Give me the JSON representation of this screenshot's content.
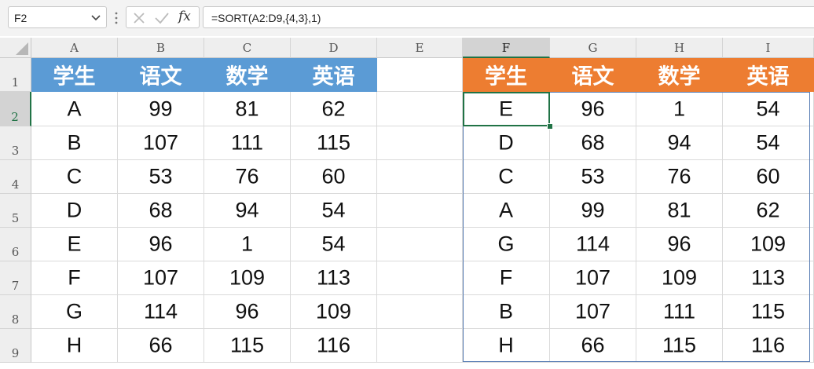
{
  "formula_bar": {
    "name_box": "F2",
    "formula": "=SORT(A2:D9,{4,3},1)",
    "fx_label": "fx"
  },
  "columns": [
    "A",
    "B",
    "C",
    "D",
    "E",
    "F",
    "G",
    "H",
    "I"
  ],
  "selected_column": "F",
  "rows": [
    "1",
    "2",
    "3",
    "4",
    "5",
    "6",
    "7",
    "8",
    "9"
  ],
  "selected_row": "2",
  "source_table": {
    "headers": [
      "学生",
      "语文",
      "数学",
      "英语"
    ],
    "rows": [
      [
        "A",
        "99",
        "81",
        "62"
      ],
      [
        "B",
        "107",
        "111",
        "115"
      ],
      [
        "C",
        "53",
        "76",
        "60"
      ],
      [
        "D",
        "68",
        "94",
        "54"
      ],
      [
        "E",
        "96",
        "1",
        "54"
      ],
      [
        "F",
        "107",
        "109",
        "113"
      ],
      [
        "G",
        "114",
        "96",
        "109"
      ],
      [
        "H",
        "66",
        "115",
        "116"
      ]
    ],
    "header_color": "#5b9bd5"
  },
  "result_table": {
    "headers": [
      "学生",
      "语文",
      "数学",
      "英语"
    ],
    "rows": [
      [
        "E",
        "96",
        "1",
        "54"
      ],
      [
        "D",
        "68",
        "94",
        "54"
      ],
      [
        "C",
        "53",
        "76",
        "60"
      ],
      [
        "A",
        "99",
        "81",
        "62"
      ],
      [
        "G",
        "114",
        "96",
        "109"
      ],
      [
        "F",
        "107",
        "109",
        "113"
      ],
      [
        "B",
        "107",
        "111",
        "115"
      ],
      [
        "H",
        "66",
        "115",
        "116"
      ]
    ],
    "header_color": "#ed7d31"
  },
  "icons": {
    "name_box_dropdown": "chevron-down-icon",
    "separator": "vertical-dots-icon",
    "cancel": "close-icon",
    "enter": "checkmark-icon",
    "insert_function": "fx-icon",
    "select_all": "select-all-triangle-icon"
  }
}
